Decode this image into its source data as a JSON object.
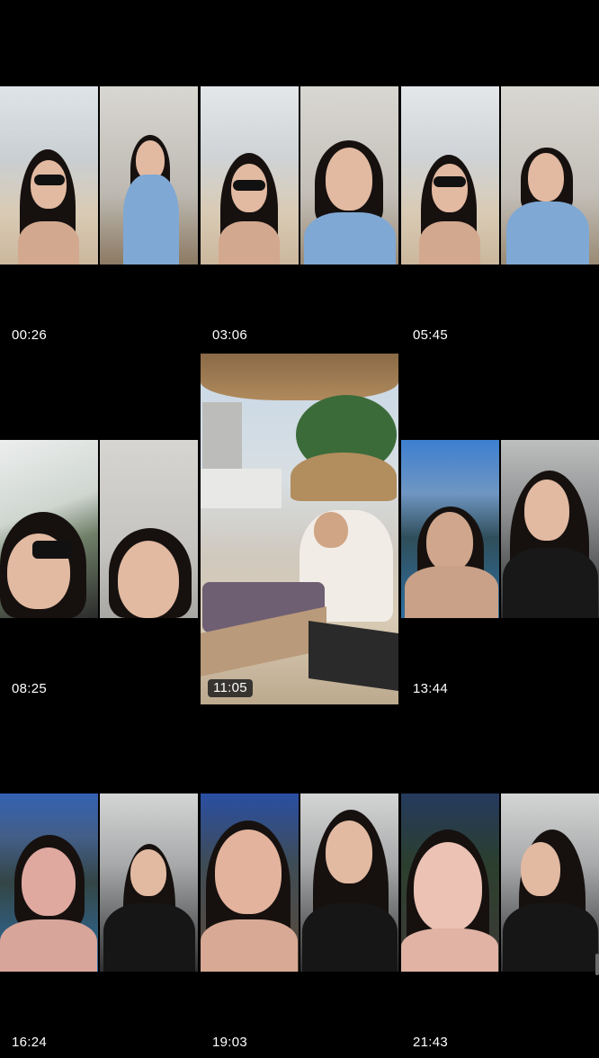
{
  "colors": {
    "background": "#000000",
    "timestamp_text": "#ffffff",
    "pill_background": "#1e1e1e"
  },
  "clips": [
    {
      "id": "clip-1",
      "timestamp": "00:26",
      "layout": "split",
      "scene_left": "beach-sunglasses",
      "scene_right": "room-blue-dress"
    },
    {
      "id": "clip-2",
      "timestamp": "03:06",
      "layout": "split",
      "scene_left": "beach-sunglasses",
      "scene_right": "room-blue-dress"
    },
    {
      "id": "clip-3",
      "timestamp": "05:45",
      "layout": "split",
      "scene_left": "beach-sunglasses",
      "scene_right": "room-blue-dress"
    },
    {
      "id": "clip-4",
      "timestamp": "08:25",
      "layout": "split",
      "scene_left": "selfie-sunglasses",
      "scene_right": "room-closeup"
    },
    {
      "id": "clip-5",
      "timestamp": "11:05",
      "layout": "full",
      "scene": "beach-resort-lounger",
      "selected": true
    },
    {
      "id": "clip-6",
      "timestamp": "13:44",
      "layout": "split",
      "scene_left": "pool-night",
      "scene_right": "room-black-pajamas"
    },
    {
      "id": "clip-7",
      "timestamp": "16:24",
      "layout": "split",
      "scene_left": "pool-night",
      "scene_right": "room-black-pajamas"
    },
    {
      "id": "clip-8",
      "timestamp": "19:03",
      "layout": "split",
      "scene_left": "pool-night",
      "scene_right": "room-black-pajamas"
    },
    {
      "id": "clip-9",
      "timestamp": "21:43",
      "layout": "split",
      "scene_left": "pool-night",
      "scene_right": "room-black-pajamas"
    }
  ]
}
